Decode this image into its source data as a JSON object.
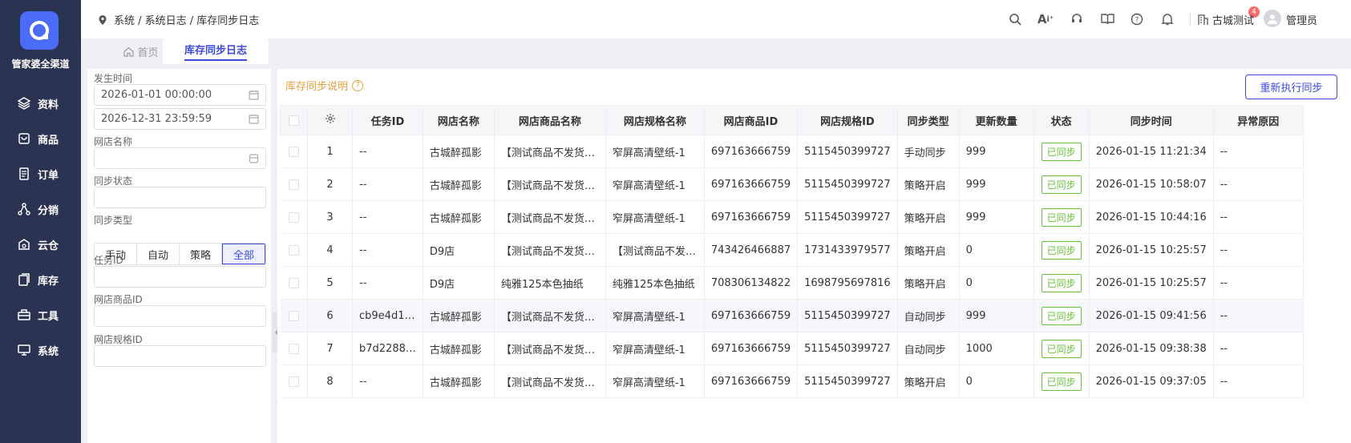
{
  "app": {
    "brand": "管家婆全渠道"
  },
  "sidebar": {
    "items": [
      {
        "label": "资料",
        "icon": "layers-icon"
      },
      {
        "label": "商品",
        "icon": "box-icon"
      },
      {
        "label": "订单",
        "icon": "document-icon"
      },
      {
        "label": "分销",
        "icon": "share-icon"
      },
      {
        "label": "云仓",
        "icon": "cloud-warehouse-icon"
      },
      {
        "label": "库存",
        "icon": "inventory-icon"
      },
      {
        "label": "工具",
        "icon": "toolbox-icon"
      },
      {
        "label": "系统",
        "icon": "monitor-icon"
      }
    ]
  },
  "header": {
    "breadcrumb": "系统 / 系统日志 / 库存同步日志",
    "notification_count": "4",
    "company": "古城测试",
    "user": "管理员"
  },
  "tabs": {
    "home": "首页",
    "active": "库存同步日志"
  },
  "filter": {
    "time_label": "发生时间",
    "time_start": "2026-01-01 00:00:00",
    "time_end": "2026-12-31 23:59:59",
    "shop_label": "网店名称",
    "shop_value": "",
    "status_label": "同步状态",
    "status_value": "",
    "type_label": "同步类型",
    "type_options": [
      "手动",
      "自动",
      "策略",
      "全部"
    ],
    "type_selected": "全部",
    "task_label": "任务ID",
    "task_value": "",
    "product_id_label": "网店商品ID",
    "product_id_value": "",
    "spec_id_label": "网店规格ID",
    "spec_id_value": ""
  },
  "main": {
    "note_label": "库存同步说明",
    "rerun_label": "重新执行同步"
  },
  "table": {
    "columns": [
      "任务ID",
      "网店名称",
      "网店商品名称",
      "网店规格名称",
      "网店商品ID",
      "网店规格ID",
      "同步类型",
      "更新数量",
      "状态",
      "同步时间",
      "异常原因"
    ],
    "rows": [
      {
        "no": "1",
        "task": "--",
        "shop": "古城醉孤影",
        "product": "【测试商品不发货…",
        "spec": "窄屏高清壁纸-1",
        "product_id": "697163666759",
        "spec_id": "5115450399727",
        "type": "手动同步",
        "qty": "999",
        "status": "已同步",
        "time": "2026-01-15 11:21:34",
        "reason": "--"
      },
      {
        "no": "2",
        "task": "--",
        "shop": "古城醉孤影",
        "product": "【测试商品不发货…",
        "spec": "窄屏高清壁纸-1",
        "product_id": "697163666759",
        "spec_id": "5115450399727",
        "type": "策略开启",
        "qty": "999",
        "status": "已同步",
        "time": "2026-01-15 10:58:07",
        "reason": "--"
      },
      {
        "no": "3",
        "task": "--",
        "shop": "古城醉孤影",
        "product": "【测试商品不发货…",
        "spec": "窄屏高清壁纸-1",
        "product_id": "697163666759",
        "spec_id": "5115450399727",
        "type": "策略开启",
        "qty": "999",
        "status": "已同步",
        "time": "2026-01-15 10:44:16",
        "reason": "--"
      },
      {
        "no": "4",
        "task": "--",
        "shop": "D9店",
        "product": "【测试商品不发货…",
        "spec": "【测试商品不发…",
        "product_id": "743426466887",
        "spec_id": "1731433979577",
        "type": "策略开启",
        "qty": "0",
        "status": "已同步",
        "time": "2026-01-15 10:25:57",
        "reason": "--"
      },
      {
        "no": "5",
        "task": "--",
        "shop": "D9店",
        "product": "纯雅125本色抽纸",
        "spec": "纯雅125本色抽纸",
        "product_id": "708306134822",
        "spec_id": "1698795697816",
        "type": "策略开启",
        "qty": "0",
        "status": "已同步",
        "time": "2026-01-15 10:25:57",
        "reason": "--"
      },
      {
        "no": "6",
        "task": "cb9e4d1…",
        "shop": "古城醉孤影",
        "product": "【测试商品不发货…",
        "spec": "窄屏高清壁纸-1",
        "product_id": "697163666759",
        "spec_id": "5115450399727",
        "type": "自动同步",
        "qty": "999",
        "status": "已同步",
        "time": "2026-01-15 09:41:56",
        "reason": "--"
      },
      {
        "no": "7",
        "task": "b7d2288…",
        "shop": "古城醉孤影",
        "product": "【测试商品不发货…",
        "spec": "窄屏高清壁纸-1",
        "product_id": "697163666759",
        "spec_id": "5115450399727",
        "type": "自动同步",
        "qty": "1000",
        "status": "已同步",
        "time": "2026-01-15 09:38:38",
        "reason": "--"
      },
      {
        "no": "8",
        "task": "--",
        "shop": "古城醉孤影",
        "product": "【测试商品不发货…",
        "spec": "窄屏高清壁纸-1",
        "product_id": "697163666759",
        "spec_id": "5115450399727",
        "type": "策略开启",
        "qty": "0",
        "status": "已同步",
        "time": "2026-01-15 09:37:05",
        "reason": "--"
      }
    ],
    "highlight_row": "6"
  },
  "colors": {
    "accent": "#3d4ad8",
    "sidebar": "#2b3352",
    "warning": "#e6a23c",
    "success": "#67c23a",
    "badge": "#f56c6c"
  }
}
